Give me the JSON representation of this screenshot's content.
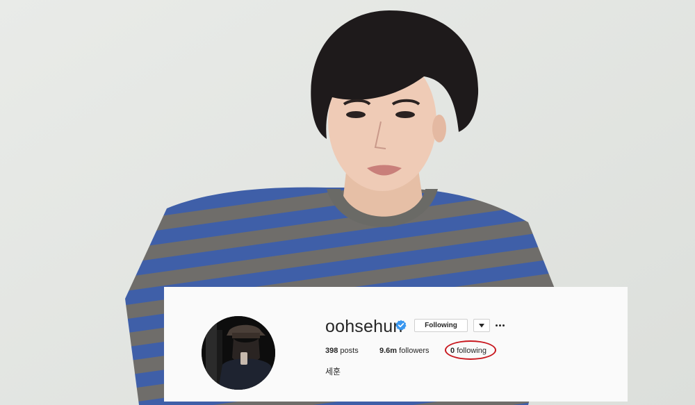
{
  "profile": {
    "username": "oohsehun",
    "verified": true,
    "buttons": {
      "following_label": "Following",
      "dropdown_icon": "caret-down-icon",
      "more_icon": "more-options-icon"
    },
    "stats": {
      "posts_count": "398",
      "posts_label": "posts",
      "followers_count": "9.6m",
      "followers_label": "followers",
      "following_count": "0",
      "following_label": "following"
    },
    "full_name": "세훈",
    "highlight_color": "#c8181f",
    "verified_color": "#3897f0"
  }
}
